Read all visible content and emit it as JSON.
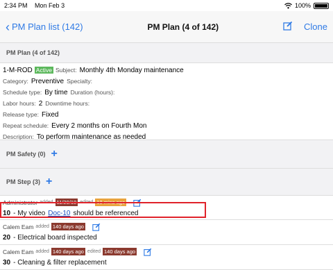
{
  "status_bar": {
    "time": "2:34 PM",
    "date": "Mon Feb 3",
    "battery": "100%",
    "battery_level": 1.0
  },
  "nav": {
    "back_label": "PM Plan list (142)",
    "title": "PM Plan (4 of 142)",
    "clone_label": "Clone"
  },
  "pm_plan": {
    "section_title": "PM Plan (4 of 142)",
    "code": "1-M-ROD",
    "status": "Active",
    "subject_label": "Subject:",
    "subject": "Monthly 4th Monday maintenance",
    "category_label": "Category:",
    "category": "Preventive",
    "specialty_label": "Specialty:",
    "schedule_type_label": "Schedule type:",
    "schedule_type": "By time",
    "duration_label": "Duration (hours):",
    "labor_hours_label": "Labor hours:",
    "labor_hours": "2",
    "downtime_label": "Downtime hours:",
    "release_type_label": "Release type:",
    "release_type": "Fixed",
    "repeat_label": "Repeat schedule:",
    "repeat": "Every 2 months on Fourth Mon",
    "description_label": "Description:",
    "description": "To perform maintenance as needed"
  },
  "pm_safety": {
    "title": "PM Safety (0)"
  },
  "pm_step": {
    "title": "PM Step (3)",
    "steps": [
      {
        "author": "Administrator",
        "added_label": "added",
        "added": "11/29/18",
        "edited_label": "edited",
        "edited": "18 mins ago",
        "num": "10",
        "text_before": "- My video",
        "link": "Doc-10",
        "text_after": "should be referenced"
      },
      {
        "author": "Calem Eam",
        "added_label": "added",
        "added": "140 days ago",
        "num": "20",
        "text_before": "- Electrical board inspected"
      },
      {
        "author": "Calem Eam",
        "added_label": "added",
        "added": "140 days ago",
        "edited_label": "edited",
        "edited": "140 days ago",
        "num": "30",
        "text_before": "- Cleaning & filter replacement"
      }
    ]
  },
  "colors": {
    "accent": "#2f7ae5",
    "active": "#5cb85c",
    "date_badge": "#8b3a2f",
    "edited_badge": "#e8a33d",
    "highlight": "#e0222a"
  },
  "icons": [
    "wifi-icon",
    "battery-icon",
    "chevron-left-icon",
    "edit-icon",
    "plus-icon"
  ]
}
